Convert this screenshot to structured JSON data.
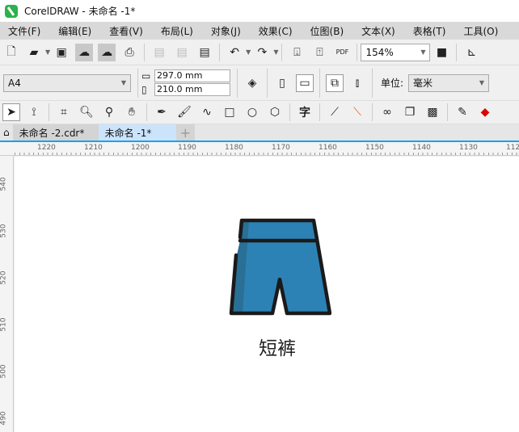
{
  "window": {
    "title": "CorelDRAW - 未命名 -1*"
  },
  "menu": [
    "文件(F)",
    "编辑(E)",
    "查看(V)",
    "布局(L)",
    "对象(J)",
    "效果(C)",
    "位图(B)",
    "文本(X)",
    "表格(T)",
    "工具(O)"
  ],
  "toolbar": {
    "zoom": "154%",
    "pdf": "PDF"
  },
  "property_bar": {
    "page_size": "A4",
    "width": "297.0 mm",
    "height": "210.0 mm",
    "unit_label": "单位:",
    "unit": "毫米"
  },
  "tools": {
    "text_tool": "字"
  },
  "tabs": [
    {
      "label": "未命名 -2.cdr*",
      "active": false
    },
    {
      "label": "未命名 -1*",
      "active": true
    }
  ],
  "ruler": {
    "h": [
      "1220",
      "1210",
      "1200",
      "1190",
      "1180",
      "1170",
      "1160",
      "1150",
      "1140",
      "1130",
      "112"
    ],
    "v": [
      "540",
      "530",
      "520",
      "510",
      "500",
      "490"
    ]
  },
  "canvas": {
    "caption": "短裤",
    "colors": {
      "fill": "#2d82b5",
      "shade": "#2a6f95",
      "outline": "#1a1a1a"
    }
  }
}
